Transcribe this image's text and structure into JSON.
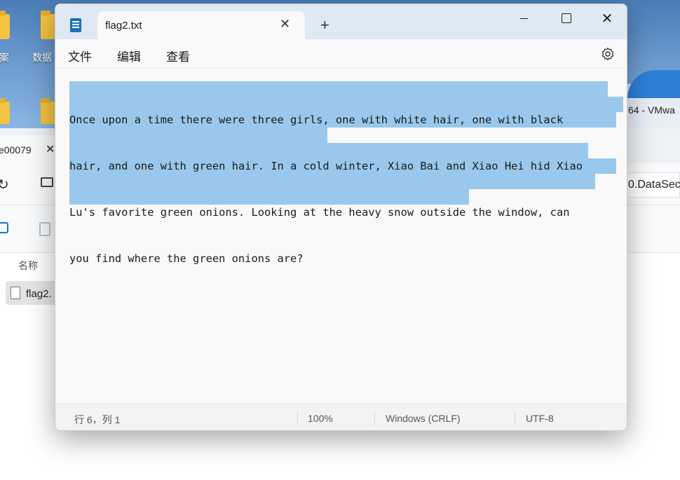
{
  "desktop": {
    "icon_labels": [
      "案",
      "数据"
    ],
    "vmware_title": "64 - VMwa"
  },
  "explorer": {
    "tab_label": "e00079",
    "address_text": "0.DataSec",
    "column_name": "名称",
    "file_label": "flag2."
  },
  "notepad": {
    "tab_title": "flag2.txt",
    "menu": {
      "file": "文件",
      "edit": "编辑",
      "view": "查看"
    },
    "content_lines": [
      "Once upon a time there were three girls, one with white hair, one with black",
      "hair, and one with green hair. In a cold winter, Xiao Bai and Xiao Hei hid Xiao",
      "Lu's favorite green onions. Looking at the heavy snow outside the window, can",
      "you find where the green onions are?"
    ],
    "status": {
      "position": "行 6，列 1",
      "zoom": "100%",
      "line_ending": "Windows (CRLF)",
      "encoding": "UTF-8"
    },
    "selection_color": "#99c8ec"
  }
}
